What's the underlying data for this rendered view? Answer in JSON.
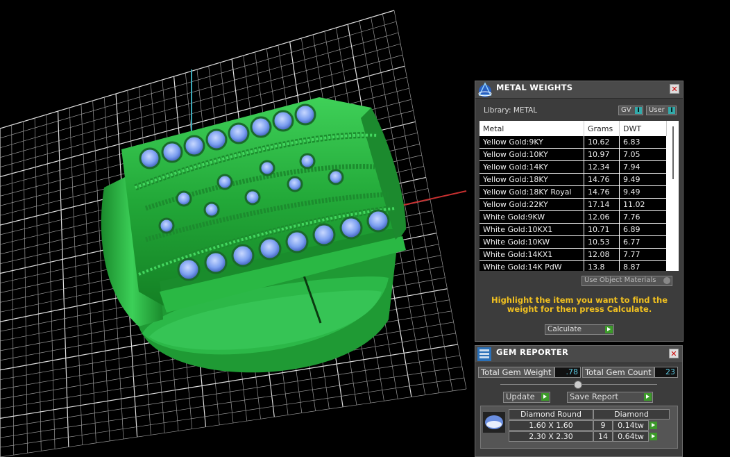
{
  "metal_weights": {
    "title": "METAL WEIGHTS",
    "library_label": "Library: METAL",
    "gv_label": "GV",
    "user_label": "User",
    "columns": [
      "Metal",
      "Grams",
      "DWT"
    ],
    "rows": [
      [
        "Yellow Gold:9KY",
        "10.62",
        "6.83"
      ],
      [
        "Yellow Gold:10KY",
        "10.97",
        "7.05"
      ],
      [
        "Yellow Gold:14KY",
        "12.34",
        "7.94"
      ],
      [
        "Yellow Gold:18KY",
        "14.76",
        "9.49"
      ],
      [
        "Yellow Gold:18KY Royal",
        "14.76",
        "9.49"
      ],
      [
        "Yellow Gold:22KY",
        "17.14",
        "11.02"
      ],
      [
        "White Gold:9KW",
        "12.06",
        "7.76"
      ],
      [
        "White Gold:10KX1",
        "10.71",
        "6.89"
      ],
      [
        "White Gold:10KW",
        "10.53",
        "6.77"
      ],
      [
        "White Gold:14KX1",
        "12.08",
        "7.77"
      ],
      [
        "White Gold:14K PdW",
        "13.8",
        "8.87"
      ]
    ],
    "use_object_materials_label": "Use Object Materials",
    "hint": "Highlight the item you want to find the weight for then press Calculate.",
    "calculate_label": "Calculate"
  },
  "gem_reporter": {
    "title": "GEM REPORTER",
    "total_weight_label": "Total Gem Weight",
    "total_weight_value": ".78",
    "total_count_label": "Total Gem Count",
    "total_count_value": "23",
    "update_label": "Update",
    "save_report_label": "Save Report",
    "gem_type": "Diamond Round",
    "gem_material": "Diamond",
    "rows": [
      {
        "size": "1.60 X 1.60",
        "count": "9",
        "weight": "0.14tw"
      },
      {
        "size": "2.30 X 2.30",
        "count": "14",
        "weight": "0.64tw"
      }
    ]
  },
  "colors": {
    "ring": "#27b040",
    "gem": "#7a9ef0",
    "grid": "#bfbfbf",
    "hint": "#f0c020",
    "accent_green": "#3c9a2a"
  }
}
